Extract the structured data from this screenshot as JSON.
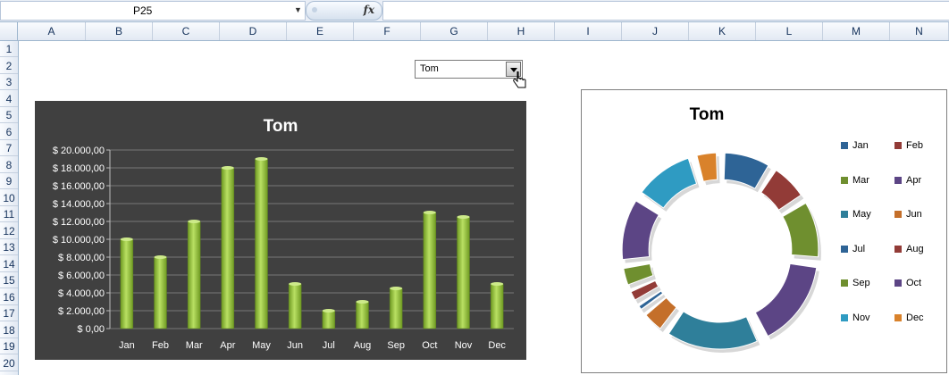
{
  "formula_bar": {
    "name_box": "P25",
    "fx_label": "fx",
    "formula": ""
  },
  "sheet": {
    "columns": [
      "A",
      "B",
      "C",
      "D",
      "E",
      "F",
      "G",
      "H",
      "I",
      "J",
      "K",
      "L",
      "M",
      "N"
    ],
    "rows": [
      "1",
      "2",
      "3",
      "4",
      "5",
      "6",
      "7",
      "8",
      "9",
      "10",
      "11",
      "12",
      "13",
      "14",
      "15",
      "16",
      "17",
      "18",
      "19",
      "20"
    ]
  },
  "dropdown": {
    "value": "Tom"
  },
  "colors": {
    "bar": "#8fbf3a",
    "bar_bg": "#404040"
  },
  "chart_data": [
    {
      "type": "bar",
      "title": "Tom",
      "categories": [
        "Jan",
        "Feb",
        "Mar",
        "Apr",
        "May",
        "Jun",
        "Jul",
        "Aug",
        "Sep",
        "Oct",
        "Nov",
        "Dec"
      ],
      "values": [
        10000,
        8000,
        12000,
        18000,
        19000,
        5000,
        2000,
        3000,
        4500,
        13000,
        12500,
        5000
      ],
      "ylim": [
        0,
        20000
      ],
      "yticks": [
        "$ 0,00",
        "$ 2.000,00",
        "$ 4.000,00",
        "$ 6.000,00",
        "$ 8.000,00",
        "$ 10.000,00",
        "$ 12.000,00",
        "$ 14.000,00",
        "$ 16.000,00",
        "$ 18.000,00",
        "$ 20.000,00"
      ],
      "grid": true,
      "legend": "none"
    },
    {
      "type": "pie",
      "variant": "donut",
      "title": "Tom",
      "categories": [
        "Jan",
        "Feb",
        "Mar",
        "Apr",
        "May",
        "Jun",
        "Jul",
        "Aug",
        "Sep",
        "Oct",
        "Nov",
        "Dec"
      ],
      "values": [
        10000,
        8000,
        12000,
        18000,
        19000,
        5000,
        2000,
        3000,
        4500,
        13000,
        12500,
        5000
      ],
      "colors": [
        "#2e6496",
        "#923b37",
        "#6f8f2f",
        "#5c4585",
        "#2f7f9a",
        "#c46f2a",
        "#2e6496",
        "#923b37",
        "#6f8f2f",
        "#5c4585",
        "#2f9bc2",
        "#d9822b"
      ],
      "legend": "right"
    }
  ]
}
